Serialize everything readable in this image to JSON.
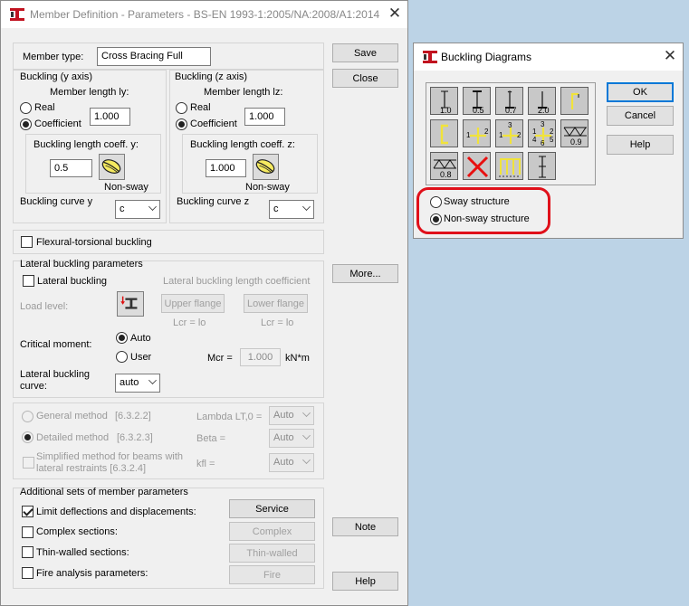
{
  "member_dialog": {
    "title": "Member Definition - Parameters - BS-EN 1993-1:2005/NA:2008/A1:2014",
    "member_type_label": "Member type:",
    "member_type_value": "Cross Bracing Full",
    "buttons": {
      "save": "Save",
      "close": "Close",
      "more": "More...",
      "note": "Note",
      "help": "Help"
    },
    "buckling_y": {
      "title": "Buckling (y axis)",
      "member_length": "Member length ly:",
      "real": "Real",
      "coefficient": "Coefficient",
      "length_value": "1.000",
      "coeff_label": "Buckling length coeff. y:",
      "coeff_value": "0.5",
      "sway_caption": "Non-sway",
      "curve_label": "Buckling curve y",
      "curve_value": "c"
    },
    "buckling_z": {
      "title": "Buckling (z axis)",
      "member_length": "Member length lz:",
      "real": "Real",
      "coefficient": "Coefficient",
      "length_value": "1.000",
      "coeff_label": "Buckling length coeff. z:",
      "coeff_value": "1.000",
      "sway_caption": "Non-sway",
      "curve_label": "Buckling curve z",
      "curve_value": "c"
    },
    "flexural_torsional": "Flexural-torsional buckling",
    "lateral": {
      "title": "Lateral buckling parameters",
      "lateral_buckling": "Lateral buckling",
      "length_coeff": "Lateral buckling length coefficient",
      "load_level": "Load level:",
      "upper_flange": "Upper flange",
      "lower_flange": "Lower flange",
      "lcr_upper": "Lcr =  lo",
      "lcr_lower": "Lcr =  lo",
      "critical_moment": "Critical moment:",
      "auto": "Auto",
      "user": "User",
      "mcr_label": "Mcr =",
      "mcr_value": "1.000",
      "mcr_unit": "kN*m",
      "curve_label_1": "Lateral buckling",
      "curve_label_2": "curve:",
      "curve_value": "auto"
    },
    "methods": {
      "general": "General method",
      "general_ref": "[6.3.2.2]",
      "detailed": "Detailed method",
      "detailed_ref": "[6.3.2.3]",
      "simplified_1": "Simplified method for beams with",
      "simplified_2": "lateral restraints [6.3.2.4]",
      "lambda_label": "Lambda LT,0 =",
      "beta_label": "Beta =",
      "kfl_label": "kfl =",
      "lambda_value": "Auto",
      "beta_value": "Auto",
      "kfl_value": "Auto"
    },
    "additional": {
      "title": "Additional sets of member parameters",
      "limit_deflections": "Limit deflections and displacements:",
      "complex_sections": "Complex sections:",
      "thin_walled_sections": "Thin-walled sections:",
      "fire_analysis": "Fire analysis parameters:",
      "service_btn": "Service",
      "complex_btn": "Complex",
      "thin_walled_btn": "Thin-walled",
      "fire_btn": "Fire"
    }
  },
  "buckling_dialog": {
    "title": "Buckling Diagrams",
    "ok": "OK",
    "cancel": "Cancel",
    "help": "Help",
    "sway": "Sway structure",
    "non_sway": "Non-sway structure",
    "tile_labels": [
      "1.0",
      "0.5",
      "0.7",
      "2.0",
      "",
      "",
      "",
      "",
      "",
      "0.9",
      "0.8",
      "",
      "",
      ""
    ],
    "tile_numbers": {
      "t7": [
        "1",
        "2"
      ],
      "t8": [
        "3",
        "1",
        "2"
      ],
      "t9": [
        "3",
        "1",
        "2",
        "4",
        "5",
        "6"
      ]
    }
  },
  "colors": {
    "accent": "#0078d7",
    "highlight": "#e0101a",
    "tile_bg": "#c8c8c8"
  }
}
